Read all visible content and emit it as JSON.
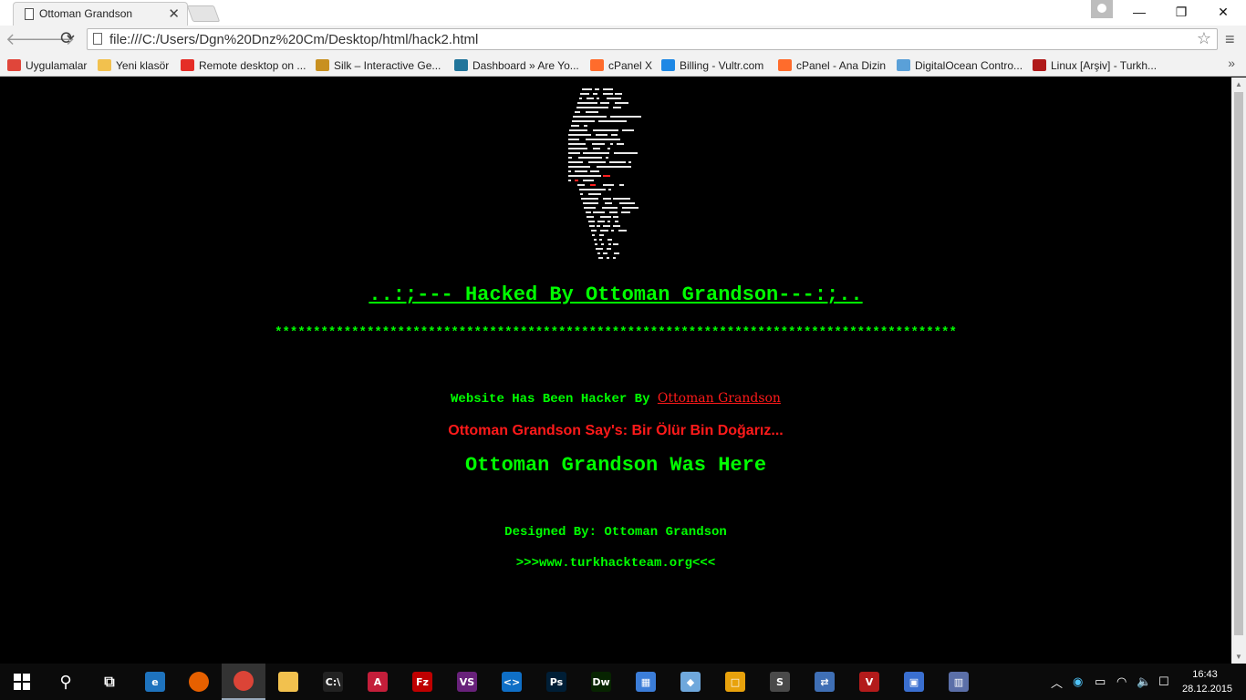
{
  "browser": {
    "tab_title": "Ottoman Grandson",
    "tab_close": "✕",
    "url": "file:///C:/Users/Dgn%20Dnz%20Cm/Desktop/html/hack2.html",
    "window_controls": {
      "minimize": "—",
      "maximize": "❐",
      "close": "✕"
    }
  },
  "bookmarks": [
    {
      "label": "Uygulamalar",
      "icon": "apps-grid-icon",
      "color": "#e0463a"
    },
    {
      "label": "Yeni klasör",
      "icon": "folder-icon",
      "color": "#f2c14e"
    },
    {
      "label": "Remote desktop on ...",
      "icon": "youtube-icon",
      "color": "#e52d27"
    },
    {
      "label": "Silk – Interactive Ge...",
      "icon": "silk-icon",
      "color": "#c89020"
    },
    {
      "label": "Dashboard » Are Yo...",
      "icon": "wordpress-icon",
      "color": "#21759b"
    },
    {
      "label": "cPanel X",
      "icon": "cpanel-icon",
      "color": "#ff6c2c"
    },
    {
      "label": "Billing - Vultr.com",
      "icon": "vultr-icon",
      "color": "#1e88e5"
    },
    {
      "label": "cPanel - Ana Dizin",
      "icon": "cpanel-icon",
      "color": "#ff6c2c"
    },
    {
      "label": "DigitalOcean Contro...",
      "icon": "digitalocean-icon",
      "color": "#5aa0d8"
    },
    {
      "label": "Linux [Arşiv] - Turkh...",
      "icon": "turkhackteam-icon",
      "color": "#b01a1a"
    }
  ],
  "page": {
    "heading": "..:;--- Hacked By Ottoman Grandson---:;..",
    "stars": "*****************************************************************************************",
    "hacker_prefix": "Website Has Been Hacker By ",
    "hacker_name": "Ottoman Grandson",
    "say_line": "Ottoman Grandson Say's: Bir Ölür Bin Doğarız...",
    "was_here": "Ottoman Grandson Was Here",
    "designed_by": "Designed By: Ottoman Grandson",
    "website": ">>>www.turkhackteam.org<<<",
    "colors": {
      "green": "#00ff00",
      "red": "#ff1a1a",
      "background": "#000000"
    }
  },
  "taskbar": {
    "apps": [
      {
        "name": "start-button",
        "icon": "windows-icon"
      },
      {
        "name": "search-button",
        "icon": "search-icon"
      },
      {
        "name": "task-view-button",
        "icon": "task-view-icon"
      },
      {
        "name": "edge",
        "icon": "edge-icon",
        "label": "e",
        "color": "#1e73be"
      },
      {
        "name": "firefox",
        "icon": "firefox-icon",
        "label": "",
        "color": "#e66000"
      },
      {
        "name": "chrome",
        "icon": "chrome-icon",
        "label": "",
        "color": "#db4437",
        "active": true
      },
      {
        "name": "file-explorer",
        "icon": "folder-icon",
        "label": "",
        "color": "#f2c14e"
      },
      {
        "name": "cmd",
        "icon": "terminal-icon",
        "label": "C:\\",
        "color": "#222222"
      },
      {
        "name": "access",
        "icon": "access-icon",
        "label": "A",
        "color": "#c41e3a"
      },
      {
        "name": "filezilla",
        "icon": "filezilla-icon",
        "label": "Fz",
        "color": "#bf0000"
      },
      {
        "name": "visual-studio",
        "icon": "visual-studio-icon",
        "label": "VS",
        "color": "#68217a"
      },
      {
        "name": "vs-code",
        "icon": "vscode-icon",
        "label": "<>",
        "color": "#0f6fc6"
      },
      {
        "name": "photoshop",
        "icon": "photoshop-icon",
        "label": "Ps",
        "color": "#001e36"
      },
      {
        "name": "dreamweaver",
        "icon": "dreamweaver-icon",
        "label": "Dw",
        "color": "#072401"
      },
      {
        "name": "control-panel",
        "icon": "control-panel-icon",
        "label": "▦",
        "color": "#3b7dd8"
      },
      {
        "name": "paint-app",
        "icon": "paint-icon",
        "label": "◆",
        "color": "#6fa8dc"
      },
      {
        "name": "virtualbox",
        "icon": "virtualbox-icon",
        "label": "□",
        "color": "#e8a20c"
      },
      {
        "name": "sublime-text",
        "icon": "sublime-icon",
        "label": "S",
        "color": "#4a4a4a"
      },
      {
        "name": "network-tool",
        "icon": "network-icon",
        "label": "⇄",
        "color": "#3f6fb5"
      },
      {
        "name": "visual-cpp",
        "icon": "vcpp-icon",
        "label": "V",
        "color": "#b31b1b"
      },
      {
        "name": "remote-desktop",
        "icon": "remote-desktop-icon",
        "label": "▣",
        "color": "#3a6fd0"
      },
      {
        "name": "app-window",
        "icon": "app-window-icon",
        "label": "▥",
        "color": "#5b6fa8"
      }
    ],
    "clock_time": "16:43",
    "clock_date": "28.12.2015"
  }
}
